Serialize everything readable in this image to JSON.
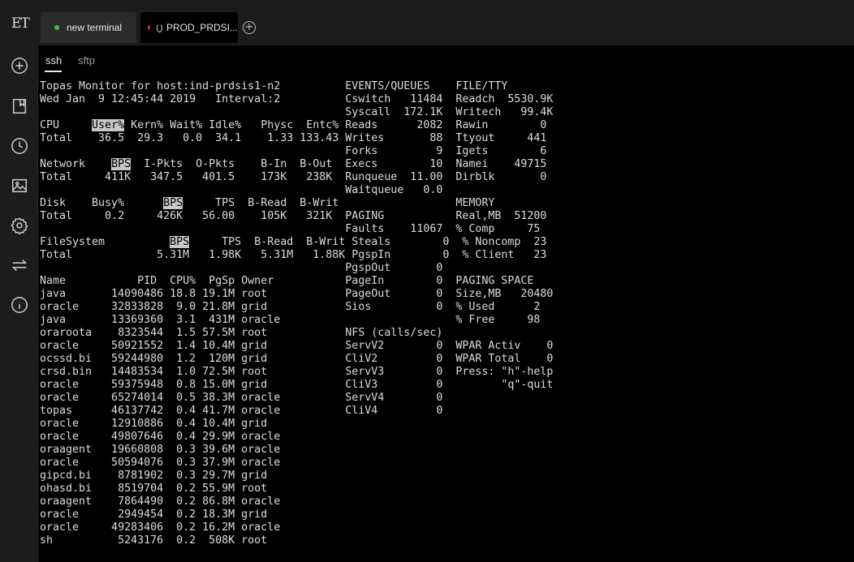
{
  "sidebar": {
    "logo_text": "ET",
    "icons": [
      "add-circle-icon",
      "bookmark-icon",
      "clock-history-icon",
      "image-icon",
      "gear-icon",
      "swap-arrows-icon",
      "info-icon"
    ]
  },
  "tabs": [
    {
      "label": "new terminal",
      "status_color": "#3fbf3f"
    },
    {
      "label": "PROD_PRDSI...",
      "status_color": "#e0283a"
    }
  ],
  "protocols": [
    "ssh",
    "sftp"
  ],
  "active_protocol": "ssh",
  "terminal": {
    "lines": [
      "Topas Monitor for host:ind-prdsis1-n2          EVENTS/QUEUES    FILE/TTY",
      "Wed Jan  9 12:45:44 2019   Interval:2          Cswitch   11484  Readch  5530.9K",
      "                                               Syscall  172.1K  Writech   99.4K",
      "CPU     User% Kern% Wait% Idle%   Physc  Entc% Reads      2082  Rawin        0",
      "Total    36.5  29.3   0.0  34.1    1.33 133.43 Writes       88  Ttyout     441",
      "                                               Forks         9  Igets        6",
      "Network    BPS  I-Pkts  O-Pkts    B-In  B-Out  Execs        10  Namei    49715",
      "Total     411K   347.5   401.5    173K   238K  Runqueue  11.00  Dirblk       0",
      "                                               Waitqueue   0.0",
      "Disk    Busy%      BPS     TPS  B-Read  B-Writ                  MEMORY",
      "Total     0.2     426K   56.00    105K   321K  PAGING           Real,MB  51200",
      "                                               Faults    11067  % Comp     75",
      "FileSystem          BPS     TPS  B-Read  B-Writ Steals        0  % Noncomp  23",
      "Total             5.31M   1.98K   5.31M   1.88K PgspIn        0  % Client   23",
      "                                               PgspOut       0",
      "Name           PID  CPU%  PgSp Owner           PageIn        0  PAGING SPACE",
      "java       14090486 18.8 19.1M root            PageOut       0  Size,MB   20480",
      "oracle     32833828  9.0 21.8M grid            Sios          0  % Used      2",
      "java       13369360  3.1  431M oracle                           % Free     98",
      "oraroota    8323544  1.5 57.5M root            NFS (calls/sec)",
      "oracle     50921552  1.4 10.4M grid            ServV2        0  WPAR Activ    0",
      "ocssd.bi   59244980  1.2  120M grid            CliV2         0  WPAR Total    0",
      "crsd.bin   14483534  1.0 72.5M root            ServV3        0  Press: \"h\"-help",
      "oracle     59375948  0.8 15.0M grid            CliV3         0         \"q\"-quit",
      "oracle     65274014  0.5 38.3M oracle          ServV4        0",
      "topas      46137742  0.4 41.7M oracle          CliV4         0",
      "oracle     12910886  0.4 10.4M grid",
      "oracle     49807646  0.4 29.9M oracle",
      "oraagent   19660808  0.3 39.6M oracle",
      "oracle     50594076  0.3 37.9M oracle",
      "gipcd.bi    8781902  0.3 29.7M grid",
      "ohasd.bi    8519704  0.2 55.9M root",
      "oraagent    7864490  0.2 86.8M oracle",
      "oracle      2949454  0.2 18.3M grid",
      "oracle     49283406  0.2 16.2M oracle",
      "sh          5243176  0.2  508K root"
    ],
    "highlighted_headers": [
      "User%",
      "BPS",
      "BPS",
      "BPS"
    ]
  }
}
